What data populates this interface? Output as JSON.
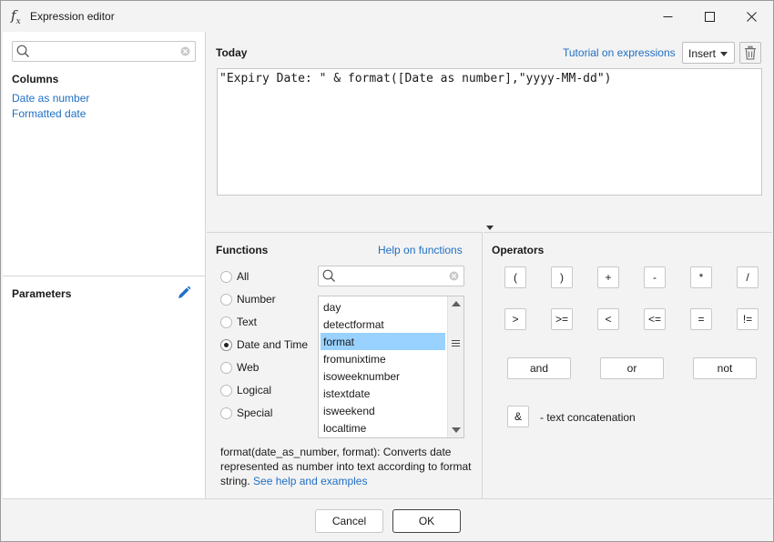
{
  "window": {
    "title": "Expression editor",
    "icon_name": "function-fx-icon",
    "controls": [
      "minimize-icon",
      "maximize-icon",
      "close-icon"
    ]
  },
  "left_panel": {
    "search": {
      "value": "",
      "placeholder": ""
    },
    "columns_title": "Columns",
    "columns": [
      "Date as number",
      "Formatted date"
    ],
    "parameters_title": "Parameters",
    "parameters_icon": "pencil-icon"
  },
  "editor": {
    "title": "Today",
    "tutorial_link": "Tutorial on expressions",
    "insert_label": "Insert",
    "delete_icon": "trash-icon",
    "expression": "\"Expiry Date: \" & format([Date as number],\"yyyy-MM-dd\")"
  },
  "functions": {
    "title": "Functions",
    "help_link": "Help on functions",
    "categories": [
      {
        "label": "All",
        "checked": false
      },
      {
        "label": "Number",
        "checked": false
      },
      {
        "label": "Text",
        "checked": false
      },
      {
        "label": "Date and Time",
        "checked": true
      },
      {
        "label": "Web",
        "checked": false
      },
      {
        "label": "Logical",
        "checked": false
      },
      {
        "label": "Special",
        "checked": false
      }
    ],
    "search": {
      "value": "",
      "placeholder": ""
    },
    "items": [
      "day",
      "detectformat",
      "format",
      "fromunixtime",
      "isoweeknumber",
      "istextdate",
      "isweekend",
      "localtime"
    ],
    "selected_item": "format",
    "description": "format(date_as_number, format): Converts date represented as number into text according to format string.",
    "description_link": "See help and examples"
  },
  "operators": {
    "title": "Operators",
    "row1": [
      "(",
      ")",
      "+",
      "-",
      "*",
      "/"
    ],
    "row2": [
      ">",
      ">=",
      "<",
      "<=",
      "=",
      "!="
    ],
    "logical": [
      "and",
      "or",
      "not"
    ],
    "concat_symbol": "&",
    "concat_label": "- text concatenation"
  },
  "footer": {
    "cancel_label": "Cancel",
    "ok_label": "OK"
  }
}
